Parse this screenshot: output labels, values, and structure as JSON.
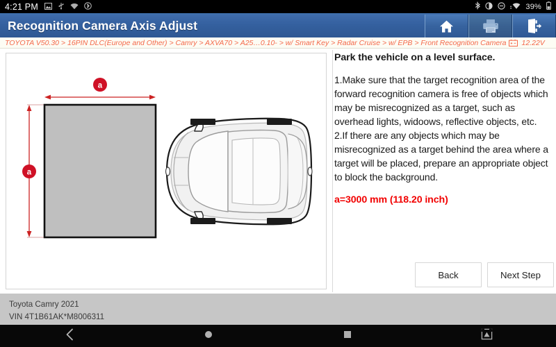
{
  "statusbar": {
    "time": "4:21 PM",
    "left_icons": [
      "image-icon",
      "usb-icon",
      "wifi-icon",
      "bluetooth-audio-icon"
    ],
    "right_icons": [
      "bluetooth-icon",
      "brightness-icon",
      "do-not-disturb-icon",
      "wifi-signal-icon"
    ],
    "battery_percent": "39%",
    "battery_icon": "battery-icon"
  },
  "titlebar": {
    "title": "Recognition Camera Axis Adjust",
    "buttons": [
      {
        "name": "home-button",
        "icon": "home-icon",
        "enabled": true
      },
      {
        "name": "print-button",
        "icon": "printer-icon",
        "enabled": false
      },
      {
        "name": "exit-button",
        "icon": "exit-icon",
        "enabled": true
      }
    ]
  },
  "breadcrumb": {
    "path": "TOYOTA V50.30 > 16PIN DLC(Europe and Other) > Camry > AXVA70 > A25…0.10- > w/ Smart Key > Radar Cruise > w/ EPB > Front Recognition Camera",
    "battery_icon": "car-battery-icon",
    "voltage": "12.22V"
  },
  "diagram": {
    "label_width": "a",
    "label_height": "a",
    "target_fill": "#bfbfbf",
    "dimension_color": "#cc0000",
    "vehicle": "top-down-car-illustration"
  },
  "instructions": {
    "heading": "Park the vehicle on a level surface.",
    "body": "1.Make sure that the target recognition area of the forward recognition camera is free of objects which may be misrecognized as a target, such as overhead lights, widoows, reflective objects, etc.\n2.If there are any objects which may be misrecognized as a target behind the area where a target will be placed, prepare an appropriate object to block the background.",
    "note": "a=3000 mm (118.20 inch)",
    "note_color": "#f20000"
  },
  "actions": {
    "back_label": "Back",
    "next_label": "Next Step"
  },
  "vehicle_info": {
    "model": "Toyota Camry 2021",
    "vin": "VIN 4T1B61AK*M8006311"
  },
  "navbar": {
    "items": [
      "back-nav-icon",
      "home-nav-icon",
      "recents-nav-icon",
      "screenshot-nav-icon"
    ]
  }
}
